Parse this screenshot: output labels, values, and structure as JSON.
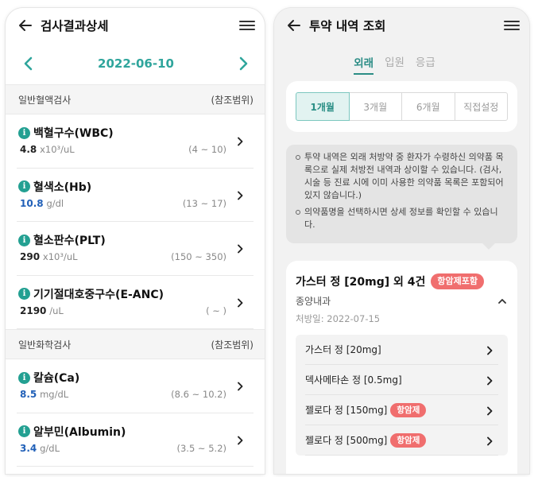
{
  "left": {
    "title": "검사결과상세",
    "date": "2022-06-10",
    "sections": [
      {
        "name": "일반혈액검사",
        "range_header": "(참조범위)",
        "items": [
          {
            "name": "백혈구수(WBC)",
            "value": "4.8",
            "unit": "x10³/uL",
            "range": "(4 ~ 10)",
            "highlight": false
          },
          {
            "name": "혈색소(Hb)",
            "value": "10.8",
            "unit": "g/dl",
            "range": "(13 ~ 17)",
            "highlight": true
          },
          {
            "name": "혈소판수(PLT)",
            "value": "290",
            "unit": "x10³/uL",
            "range": "(150 ~ 350)",
            "highlight": false
          },
          {
            "name": "기기절대호중구수(E-ANC)",
            "value": "2190",
            "unit": "/uL",
            "range": "( ~ )",
            "highlight": false
          }
        ]
      },
      {
        "name": "일반화학검사",
        "range_header": "(참조범위)",
        "items": [
          {
            "name": "칼슘(Ca)",
            "value": "8.5",
            "unit": "mg/dL",
            "range": "(8.6 ~ 10.2)",
            "highlight": true
          },
          {
            "name": "알부민(Albumin)",
            "value": "3.4",
            "unit": "g/dL",
            "range": "(3.5 ~ 5.2)",
            "highlight": true
          }
        ]
      }
    ]
  },
  "right": {
    "title": "투약 내역 조회",
    "tabs": [
      {
        "label": "외래",
        "active": true
      },
      {
        "label": "입원",
        "active": false
      },
      {
        "label": "응급",
        "active": false
      }
    ],
    "periods": [
      {
        "label": "1개월",
        "active": true
      },
      {
        "label": "3개월",
        "active": false
      },
      {
        "label": "6개월",
        "active": false
      },
      {
        "label": "직접설정",
        "active": false
      }
    ],
    "notices": [
      "투약 내역은 외래 처방약 중 환자가 수령하신 의약품 목록으로 실제 처방전 내역과 상이할 수 있습니다. (검사, 시술 등 진료 시에 이미 사용한 의약품 목록은 포함되어 있지 않습니다.)",
      "의약품명을 선택하시면 상세 정보를 확인할 수 있습니다."
    ],
    "prescription": {
      "title": "가스터 정 [20mg] 외 4건",
      "badge": "항암제포함",
      "department": "종양내과",
      "date": "처방일: 2022-07-15",
      "drugs": [
        {
          "name": "가스터 정 [20mg]",
          "badge": ""
        },
        {
          "name": "덱사메타손 정 [0.5mg]",
          "badge": ""
        },
        {
          "name": "젤로다 정 [150mg]",
          "badge": "항암제"
        },
        {
          "name": "젤로다 정 [500mg]",
          "badge": "항암제"
        }
      ]
    }
  },
  "colors": {
    "accent": "#2fa59c",
    "abnormal_value": "#2160b8",
    "badge": "#f06e6e"
  }
}
